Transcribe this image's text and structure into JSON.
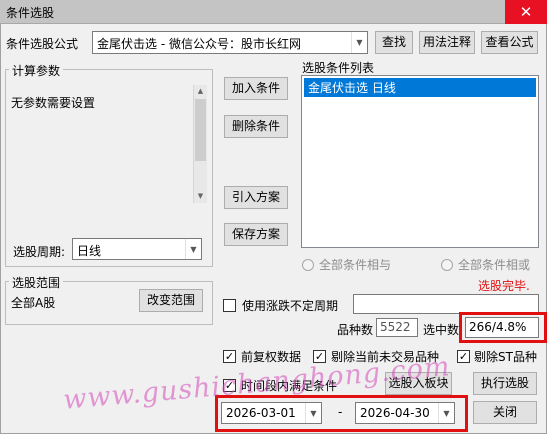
{
  "window": {
    "title": "条件选股",
    "close_glyph": "✕"
  },
  "formula": {
    "label": "条件选股公式",
    "value": "金尾伏击选  -  微信公众号：股市长红网",
    "find_button": "查找",
    "usage_button": "用法注释",
    "view_button": "查看公式"
  },
  "params": {
    "group_title": "计算参数",
    "message": "无参数需要设置",
    "period_label": "选股周期:",
    "period_value": "日线"
  },
  "actions": {
    "add": "加入条件",
    "delete": "删除条件",
    "import": "引入方案",
    "save": "保存方案"
  },
  "conditions": {
    "title": "选股条件列表",
    "items": [
      "金尾伏击选  日线"
    ],
    "and_label": "全部条件相与",
    "or_label": "全部条件相或",
    "status": "选股完毕."
  },
  "scope": {
    "group_title": "选股范围",
    "value": "全部A股",
    "change_button": "改变范围"
  },
  "options": {
    "variable_period_label": "使用涨跌不定周期",
    "count_label": "品种数",
    "count_value": "5522",
    "selected_label": "选中数",
    "selected_value": "266/4.8%",
    "pre_adjust_label": "前复权数据",
    "exclude_untraded_label": "剔除当前未交易品种",
    "exclude_st_label": "剔除ST品种",
    "time_range_label": "时间段内满足条件",
    "to_block_button": "选股入板块",
    "run_button": "执行选股"
  },
  "date_range": {
    "start": "2026-03-01",
    "separator": "-",
    "end": "2026-04-30",
    "close_button": "关闭"
  },
  "watermark": "www.gushichanghong.com",
  "colors": {
    "accent": "#0078d7",
    "close": "#e81123",
    "status": "#e01010",
    "watermark": "#d44ab8"
  }
}
